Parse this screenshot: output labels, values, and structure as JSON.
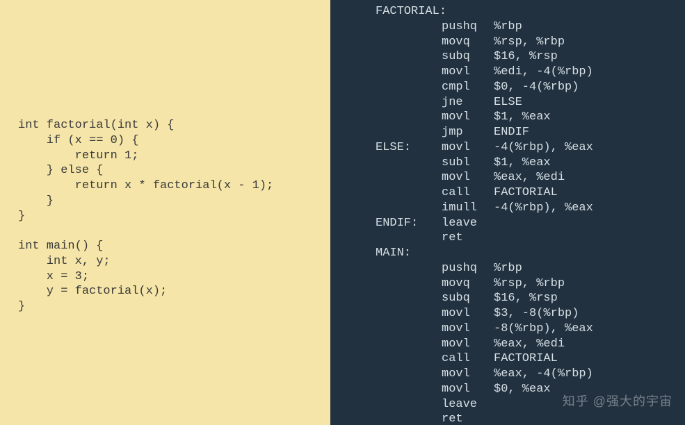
{
  "c_code": {
    "lines": [
      "int factorial(int x) {",
      "    if (x == 0) {",
      "        return 1;",
      "    } else {",
      "        return x * factorial(x - 1);",
      "    }",
      "}",
      "",
      "int main() {",
      "    int x, y;",
      "    x = 3;",
      "    y = factorial(x);",
      "}"
    ]
  },
  "asm_code": {
    "lines": [
      {
        "label": "FACTORIAL:",
        "mnemonic": "",
        "operands": ""
      },
      {
        "label": "",
        "mnemonic": "pushq",
        "operands": "%rbp"
      },
      {
        "label": "",
        "mnemonic": "movq",
        "operands": "%rsp, %rbp"
      },
      {
        "label": "",
        "mnemonic": "subq",
        "operands": "$16, %rsp"
      },
      {
        "label": "",
        "mnemonic": "movl",
        "operands": "%edi, -4(%rbp)"
      },
      {
        "label": "",
        "mnemonic": "cmpl",
        "operands": "$0, -4(%rbp)"
      },
      {
        "label": "",
        "mnemonic": "jne",
        "operands": "ELSE"
      },
      {
        "label": "",
        "mnemonic": "movl",
        "operands": "$1, %eax"
      },
      {
        "label": "",
        "mnemonic": "jmp",
        "operands": "ENDIF"
      },
      {
        "label": "ELSE:",
        "mnemonic": "movl",
        "operands": "-4(%rbp), %eax"
      },
      {
        "label": "",
        "mnemonic": "subl",
        "operands": "$1, %eax"
      },
      {
        "label": "",
        "mnemonic": "movl",
        "operands": "%eax, %edi"
      },
      {
        "label": "",
        "mnemonic": "call",
        "operands": "FACTORIAL"
      },
      {
        "label": "",
        "mnemonic": "imull",
        "operands": "-4(%rbp), %eax"
      },
      {
        "label": "ENDIF:",
        "mnemonic": "leave",
        "operands": ""
      },
      {
        "label": "",
        "mnemonic": "ret",
        "operands": ""
      },
      {
        "label": "MAIN:",
        "mnemonic": "",
        "operands": ""
      },
      {
        "label": "",
        "mnemonic": "pushq",
        "operands": "%rbp"
      },
      {
        "label": "",
        "mnemonic": "movq",
        "operands": "%rsp, %rbp"
      },
      {
        "label": "",
        "mnemonic": "subq",
        "operands": "$16, %rsp"
      },
      {
        "label": "",
        "mnemonic": "movl",
        "operands": "$3, -8(%rbp)"
      },
      {
        "label": "",
        "mnemonic": "movl",
        "operands": "-8(%rbp), %eax"
      },
      {
        "label": "",
        "mnemonic": "movl",
        "operands": "%eax, %edi"
      },
      {
        "label": "",
        "mnemonic": "call",
        "operands": "FACTORIAL"
      },
      {
        "label": "",
        "mnemonic": "movl",
        "operands": "%eax, -4(%rbp)"
      },
      {
        "label": "",
        "mnemonic": "movl",
        "operands": "$0, %eax"
      },
      {
        "label": "",
        "mnemonic": "leave",
        "operands": ""
      },
      {
        "label": "",
        "mnemonic": "ret",
        "operands": ""
      }
    ]
  },
  "watermark": "知乎 @强大的宇宙",
  "colors": {
    "left_bg": "#f5e5a8",
    "right_bg": "#22313f",
    "right_text": "#d5dfe5"
  }
}
